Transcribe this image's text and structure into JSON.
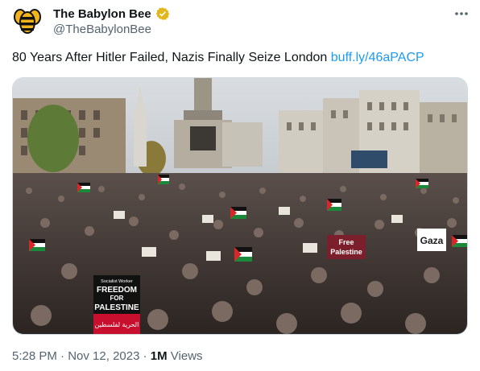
{
  "author": {
    "display_name": "The Babylon Bee",
    "handle": "@TheBabylonBee",
    "avatar_icon": "bee-logo-icon",
    "verified_icon": "verified-gold-badge-icon",
    "verified_color": "#e2b719"
  },
  "more_icon": "more-dots-icon",
  "tweet": {
    "text": "80 Years After Hitler Failed, Nazis Finally Seize London ",
    "link": "buff.ly/46aPACP"
  },
  "media": {
    "description_icon": "protest-photo",
    "signs": {
      "sign_1_line1": "Socialist Worker",
      "sign_1_line2": "FREEDOM",
      "sign_1_line3": "FOR",
      "sign_1_line4": "PALESTINE",
      "sign_1_arabic": "الحرية لفلسطين",
      "sign_2_line1": "Free",
      "sign_2_line2": "Palestine",
      "sign_3": "Gaza"
    }
  },
  "meta": {
    "time": "5:28 PM",
    "sep1": " · ",
    "date": "Nov 12, 2023",
    "sep2": " · ",
    "views_count": "1M",
    "views_label": " Views"
  },
  "colors": {
    "link": "#1d9bf0",
    "secondary_text": "#536471",
    "primary_text": "#0f1419"
  }
}
